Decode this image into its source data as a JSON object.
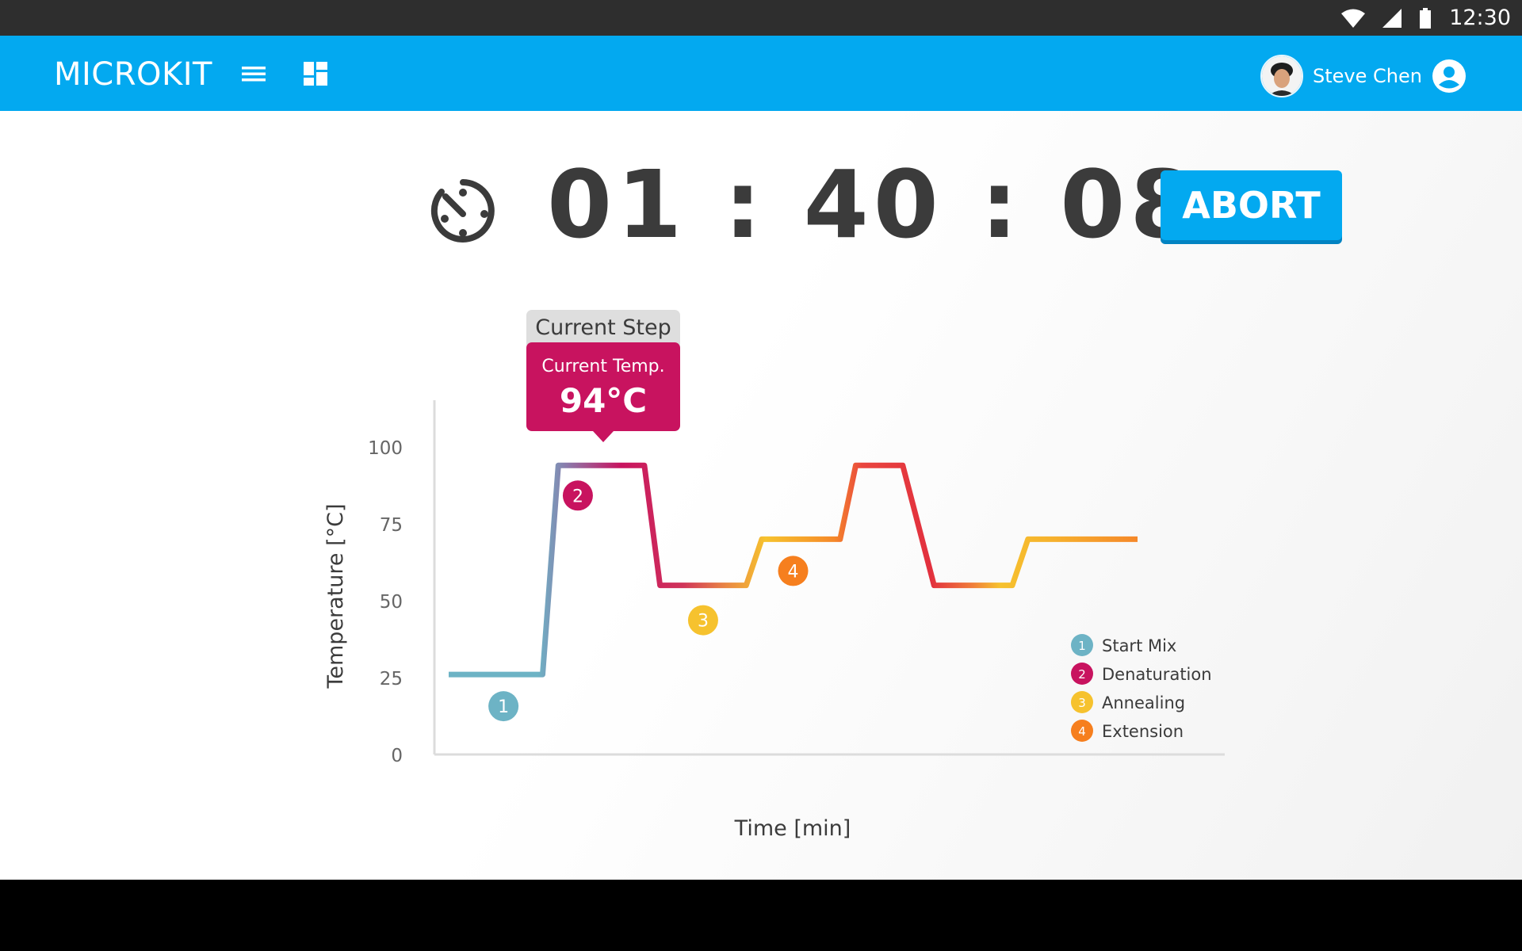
{
  "status_bar": {
    "time": "12:30",
    "icons": [
      "wifi-icon",
      "cell-signal-icon",
      "battery-icon"
    ]
  },
  "app_bar": {
    "title": "MICROKIT",
    "icons": [
      "menu-icon",
      "dashboard-icon",
      "account-circle-icon"
    ],
    "user": {
      "name": "Steve Chen"
    }
  },
  "timer": {
    "icon": "timer-icon",
    "hours": "01",
    "minutes": "40",
    "seconds": "08",
    "separator": ":"
  },
  "abort_button": {
    "label": "ABORT"
  },
  "current_step": {
    "header": "Current Step",
    "temp_label": "Current Temp.",
    "temp_value": "94°C"
  },
  "colors": {
    "primary": "#03a9f0",
    "start_mix": "#6db3c5",
    "denaturation": "#c8135f",
    "annealing": "#f6c22e",
    "extension": "#f67f1e",
    "status_bar": "#2e2e2e"
  },
  "chart_data": {
    "type": "line",
    "xlabel": "Time [min]",
    "ylabel": "Temperature [°C]",
    "ylim": [
      0,
      100
    ],
    "yticks": [
      0,
      25,
      50,
      75,
      100
    ],
    "grid": false,
    "legend_position": "bottom-right",
    "series": [
      {
        "x": [
          0,
          12,
          14,
          25,
          27,
          38,
          40,
          50,
          52,
          58,
          62,
          72,
          74,
          88
        ],
        "y": [
          26,
          26,
          94,
          94,
          55,
          55,
          70,
          70,
          94,
          94,
          55,
          55,
          70,
          70
        ]
      }
    ],
    "steps": [
      {
        "number": "1",
        "label": "Start Mix",
        "color": "#6db3c5"
      },
      {
        "number": "2",
        "label": "Denaturation",
        "color": "#c8135f"
      },
      {
        "number": "3",
        "label": "Annealing",
        "color": "#f6c22e"
      },
      {
        "number": "4",
        "label": "Extension",
        "color": "#f67f1e"
      }
    ]
  }
}
